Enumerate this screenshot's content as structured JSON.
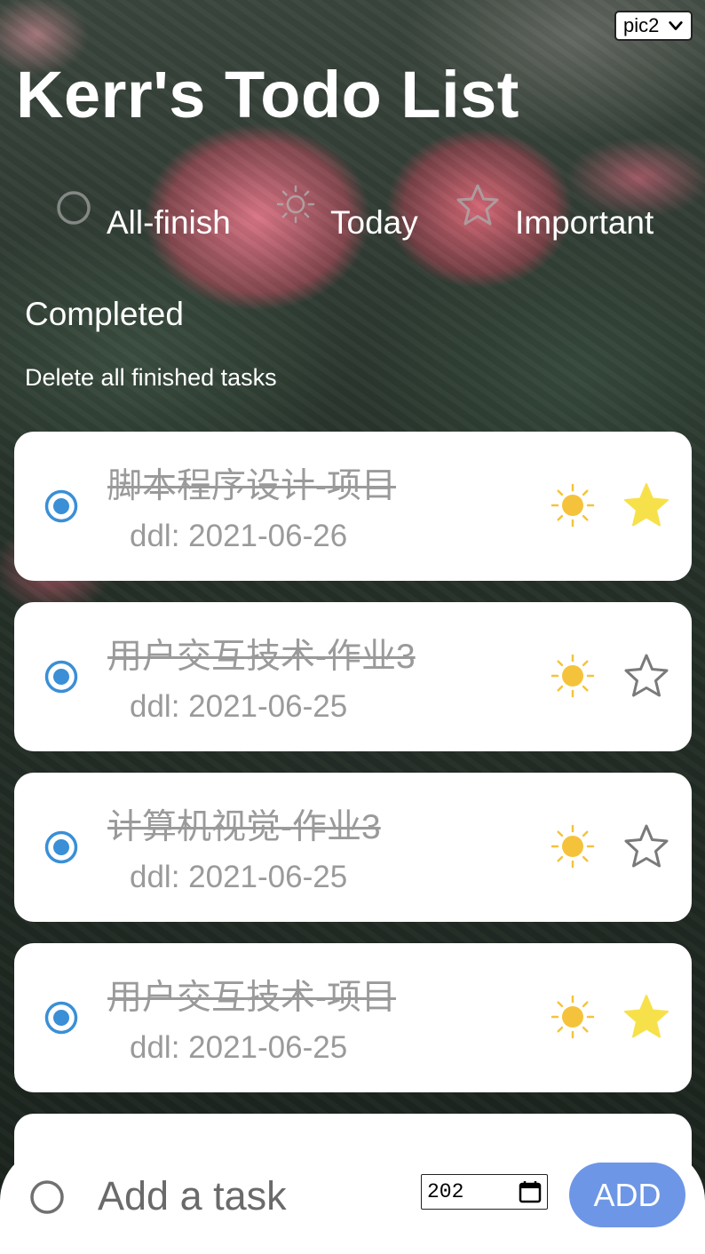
{
  "background_select": {
    "value": "pic2"
  },
  "header": {
    "title": "Kerr's Todo List"
  },
  "nav": {
    "tabs": [
      {
        "label": "All-finish",
        "icon": "circle-icon"
      },
      {
        "label": "Today",
        "icon": "sun-icon"
      },
      {
        "label": "Important",
        "icon": "star-icon"
      }
    ]
  },
  "section": {
    "title": "Completed",
    "delete_label": "Delete all finished tasks"
  },
  "tasks": [
    {
      "title": "脚本程序设计-项目",
      "ddl": "ddl: 2021-06-26",
      "completed": true,
      "today": true,
      "important": true
    },
    {
      "title": "用户交互技术-作业3",
      "ddl": "ddl: 2021-06-25",
      "completed": true,
      "today": true,
      "important": false
    },
    {
      "title": "计算机视觉-作业3",
      "ddl": "ddl: 2021-06-25",
      "completed": true,
      "today": true,
      "important": false
    },
    {
      "title": "用户交互技术-项目",
      "ddl": "ddl: 2021-06-25",
      "completed": true,
      "today": true,
      "important": true
    }
  ],
  "add_bar": {
    "placeholder": "Add a task",
    "date_value": "202",
    "add_label": "ADD"
  },
  "colors": {
    "radio_blue": "#3a8fd6",
    "sun_yellow": "#f5c33b",
    "star_yellow": "#f7e14b",
    "add_button": "#6e96e6",
    "completed_text": "#9a9a9a"
  }
}
